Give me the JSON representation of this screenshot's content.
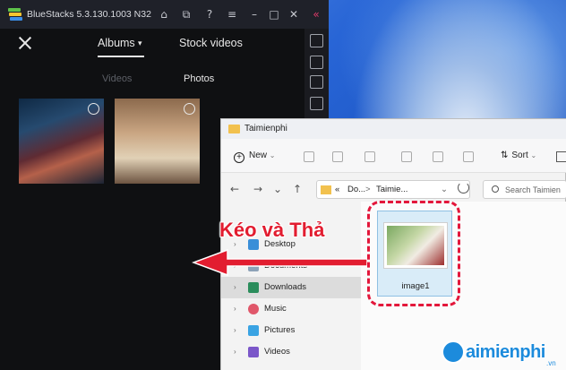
{
  "bluestacks": {
    "title": "BlueStacks 5.3.130.1003 N32",
    "window_controls": [
      "home-icon",
      "multi-instance-icon",
      "help-icon",
      "menu-icon",
      "minimize-icon",
      "maximize-icon",
      "close-icon",
      "collapse-icon"
    ],
    "tabs": [
      {
        "label": "Albums",
        "selected": true
      },
      {
        "label": "Stock videos",
        "selected": false
      }
    ],
    "subtabs": [
      {
        "label": "Videos",
        "selected": false
      },
      {
        "label": "Photos",
        "selected": true
      }
    ],
    "photos_count": 2
  },
  "explorer": {
    "title": "Taimienphi",
    "new_label": "New",
    "sort_label": "Sort",
    "breadcrumb": [
      "«",
      "Do...",
      ">",
      "Taimie..."
    ],
    "search_placeholder": "Search Taimien",
    "nav_items": [
      {
        "label": "Desktop",
        "icon": "desktop-icon"
      },
      {
        "label": "Documents",
        "icon": "documents-icon"
      },
      {
        "label": "Downloads",
        "icon": "downloads-icon",
        "selected": true
      },
      {
        "label": "Music",
        "icon": "music-icon"
      },
      {
        "label": "Pictures",
        "icon": "pictures-icon"
      },
      {
        "label": "Videos",
        "icon": "videos-icon"
      }
    ],
    "file": {
      "name": "image1"
    }
  },
  "annotation": {
    "text": "Kéo và Thả",
    "color": "#e21d30"
  },
  "watermark": {
    "text": "aimienphi",
    "suffix": ".vn"
  },
  "colors": {
    "bluestacks_bg": "#0f1012",
    "explorer_bg": "#f3f3f3",
    "accent_red": "#e3173b",
    "watermark_blue": "#1c8bdc"
  }
}
